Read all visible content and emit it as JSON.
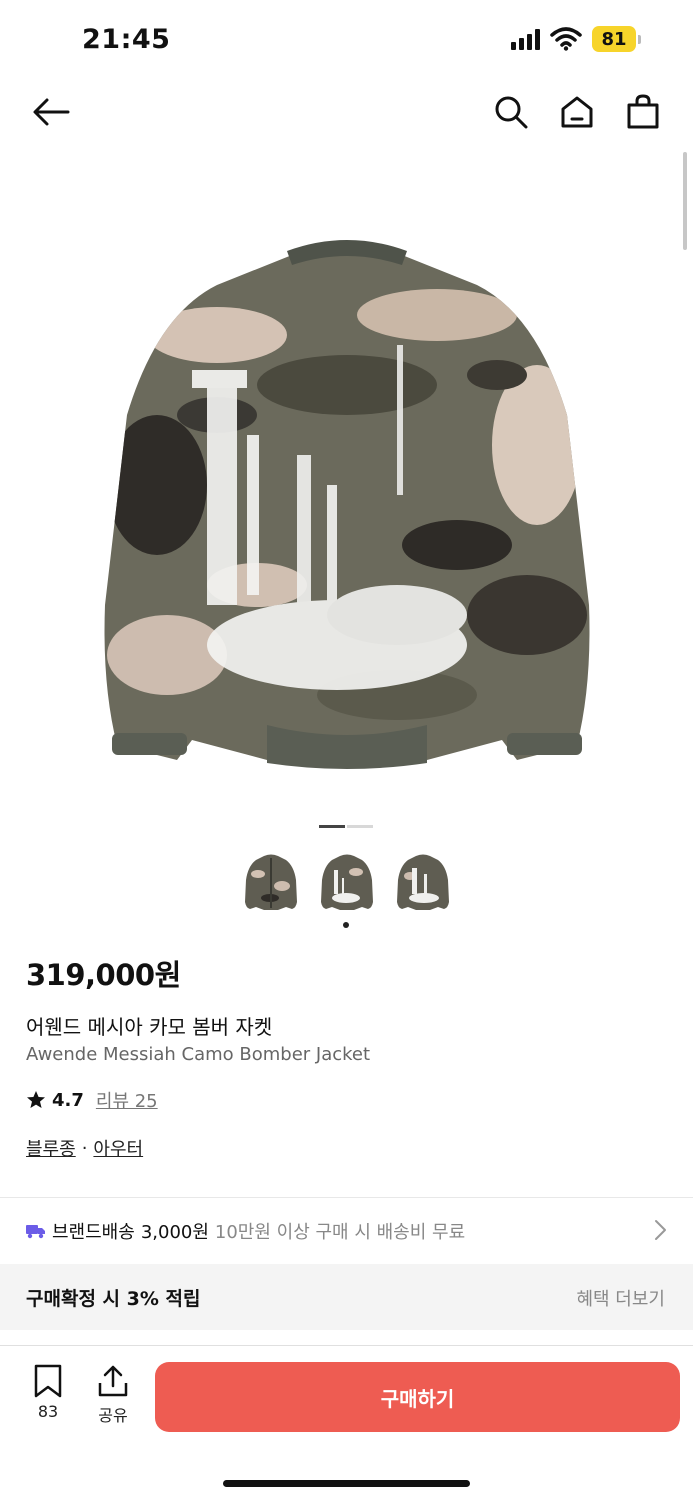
{
  "status_bar": {
    "time": "21:45",
    "battery": "81"
  },
  "product": {
    "price": "319,000원",
    "name_ko": "어웬드 메시아 카모 봄버 자켓",
    "name_en": "Awende Messiah Camo Bomber Jacket",
    "rating": "4.7",
    "review_label": "리뷰 25",
    "categories": [
      "블루종",
      "아우터"
    ],
    "category_separator": "·",
    "image_count": 2,
    "active_image_index": 1,
    "thumbnail_count": 3,
    "selected_thumbnail_index": 1
  },
  "shipping": {
    "label": "브랜드배송",
    "price": "3,000원",
    "note": "10만원 이상 구매 시 배송비 무료"
  },
  "benefit": {
    "text": "구매확정 시 3% 적립",
    "more": "혜택 더보기"
  },
  "bottom_bar": {
    "bookmark_count": "83",
    "share_label": "공유",
    "buy_label": "구매하기"
  },
  "colors": {
    "accent": "#ee5c52",
    "shipping_icon": "#6b5ce7",
    "battery": "#f7d42a"
  },
  "icons": [
    "back-arrow-icon",
    "search-icon",
    "home-icon",
    "shopping-bag-icon",
    "truck-icon",
    "chevron-right-icon",
    "bookmark-icon",
    "share-icon",
    "star-icon"
  ]
}
